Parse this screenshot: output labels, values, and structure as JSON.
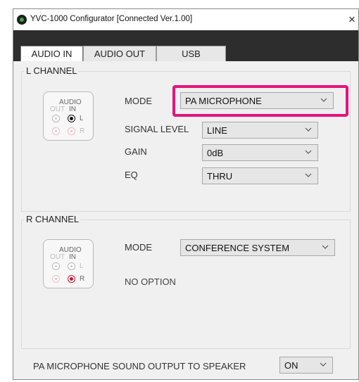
{
  "window": {
    "title": "YVC-1000 Configurator  [Connected  Ver.1.00]",
    "close_label": "×"
  },
  "tabs": [
    {
      "label": "AUDIO IN",
      "active": true
    },
    {
      "label": "AUDIO OUT",
      "active": false
    },
    {
      "label": "USB",
      "active": false
    }
  ],
  "l_channel": {
    "label": "L CHANNEL",
    "diagram": {
      "title": "AUDIO",
      "out": "OUT",
      "in": "IN",
      "l": "L",
      "r": "R"
    },
    "mode_label": "MODE",
    "mode_value": "PA MICROPHONE",
    "signal_level_label": "SIGNAL LEVEL",
    "signal_level_value": "LINE",
    "gain_label": "GAIN",
    "gain_value": "0dB",
    "eq_label": "EQ",
    "eq_value": "THRU"
  },
  "r_channel": {
    "label": "R CHANNEL",
    "diagram": {
      "title": "AUDIO",
      "out": "OUT",
      "in": "IN",
      "l": "L",
      "r": "R"
    },
    "mode_label": "MODE",
    "mode_value": "CONFERENCE SYSTEM",
    "no_option": "NO OPTION"
  },
  "footer": {
    "label": "PA MICROPHONE SOUND OUTPUT TO SPEAKER",
    "value": "ON"
  },
  "colors": {
    "highlight": "#e5147a",
    "title_bar": "#ffffff",
    "dark_band": "#2d2d2d",
    "panel": "#f0f0f0",
    "active_red": "#d0102f",
    "dim_pink": "#f4b6c4"
  }
}
